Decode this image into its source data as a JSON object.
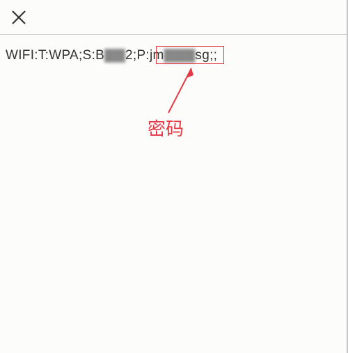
{
  "wifi": {
    "prefix": "WIFI:T:",
    "type": "WPA",
    "ssid_label": ";S:B",
    "ssid_blurred": "▇▇",
    "ssid_suffix": "2",
    "pwd_label": ";P:",
    "pwd_start": "jm",
    "pwd_blurred": "▇▇▇",
    "pwd_end": "sg",
    "terminator": ";;"
  },
  "annotation": {
    "label": "密码"
  },
  "colors": {
    "highlight": "#e63946"
  }
}
